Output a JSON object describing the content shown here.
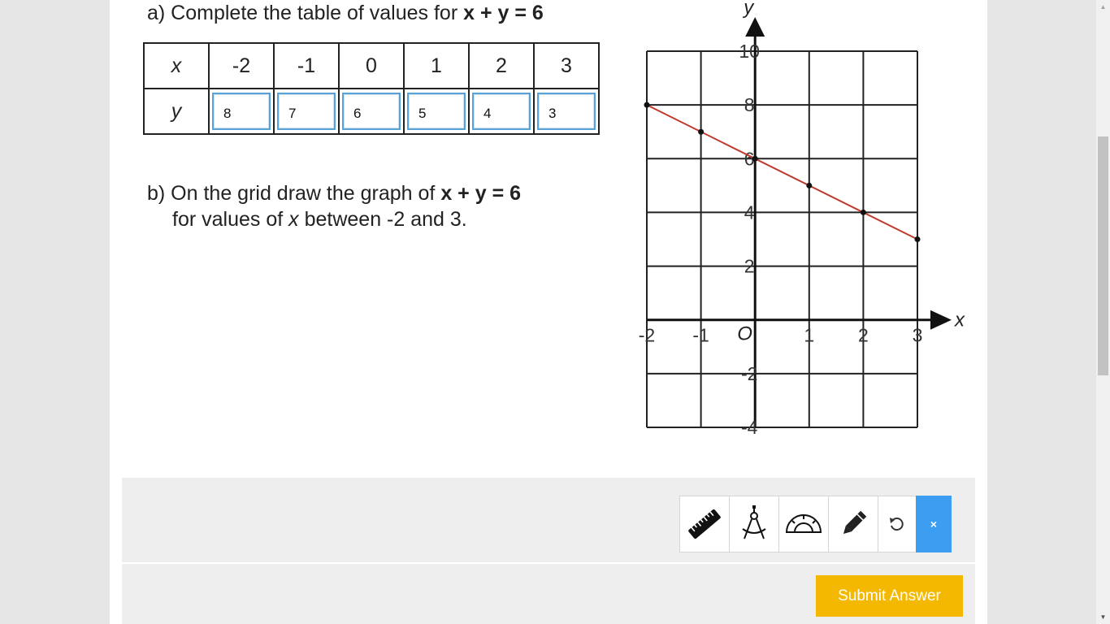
{
  "question_a": {
    "prefix": "a) Complete the table of values for ",
    "equation": "x + y = 6"
  },
  "table": {
    "x_label": "x",
    "y_label": "y",
    "x_values": [
      "-2",
      "-1",
      "0",
      "1",
      "2",
      "3"
    ],
    "y_answers": [
      "8",
      "7",
      "6",
      "5",
      "4",
      "3"
    ]
  },
  "question_b": {
    "line1_prefix": "b) On the grid draw the graph of ",
    "equation": "x + y = 6",
    "line2_prefix": "for values of ",
    "line2_var": "x",
    "line2_suffix": " between -2 and 3."
  },
  "graph": {
    "x_axis_label": "x",
    "y_axis_label": "y",
    "origin_label": "O",
    "x_tick_labels": [
      "-2",
      "-1",
      "1",
      "2",
      "3"
    ],
    "y_tick_labels": [
      "10",
      "8",
      "6",
      "4",
      "2",
      "-2",
      "-4"
    ],
    "line_color": "#c0392b"
  },
  "chart_data": {
    "type": "line",
    "x": [
      -2,
      -1,
      0,
      1,
      2,
      3
    ],
    "series": [
      {
        "values": [
          8,
          7,
          6,
          5,
          4,
          3
        ]
      }
    ],
    "xlabel": "x",
    "ylabel": "y",
    "xlim": [
      -2,
      3
    ],
    "ylim": [
      -4,
      10
    ],
    "grid": true
  },
  "toolbar": {
    "tools": [
      "ruler-icon",
      "compass-icon",
      "protractor-icon",
      "pencil-icon",
      "undo-icon"
    ],
    "close_label": "×",
    "accent": "#3d9df0"
  },
  "submit": {
    "label": "Submit Answer",
    "color": "#f5b800"
  }
}
